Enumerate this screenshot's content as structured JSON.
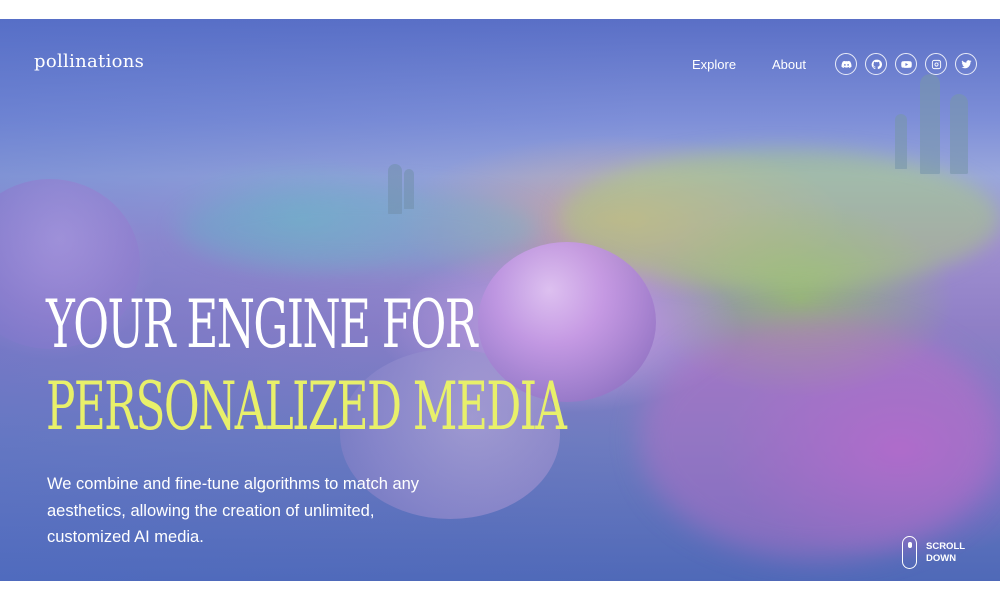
{
  "brand": {
    "logo_text": "pollinations"
  },
  "nav": {
    "links": [
      {
        "label": "Explore"
      },
      {
        "label": "About"
      }
    ],
    "social": [
      {
        "icon": "discord-icon"
      },
      {
        "icon": "github-icon"
      },
      {
        "icon": "youtube-icon"
      },
      {
        "icon": "instagram-icon"
      },
      {
        "icon": "twitter-icon"
      }
    ]
  },
  "hero": {
    "headline_line1": "YOUR ENGINE FOR",
    "headline_line2": "PERSONALIZED MEDIA",
    "description": "We combine and fine-tune algorithms to match any aesthetics, allowing the creation of unlimited, customized AI media.",
    "scroll_line1": "SCROLL",
    "scroll_line2": "DOWN"
  },
  "colors": {
    "headline_primary": "#ffffff",
    "headline_accent": "#e8f06a",
    "text": "#ffffff"
  }
}
